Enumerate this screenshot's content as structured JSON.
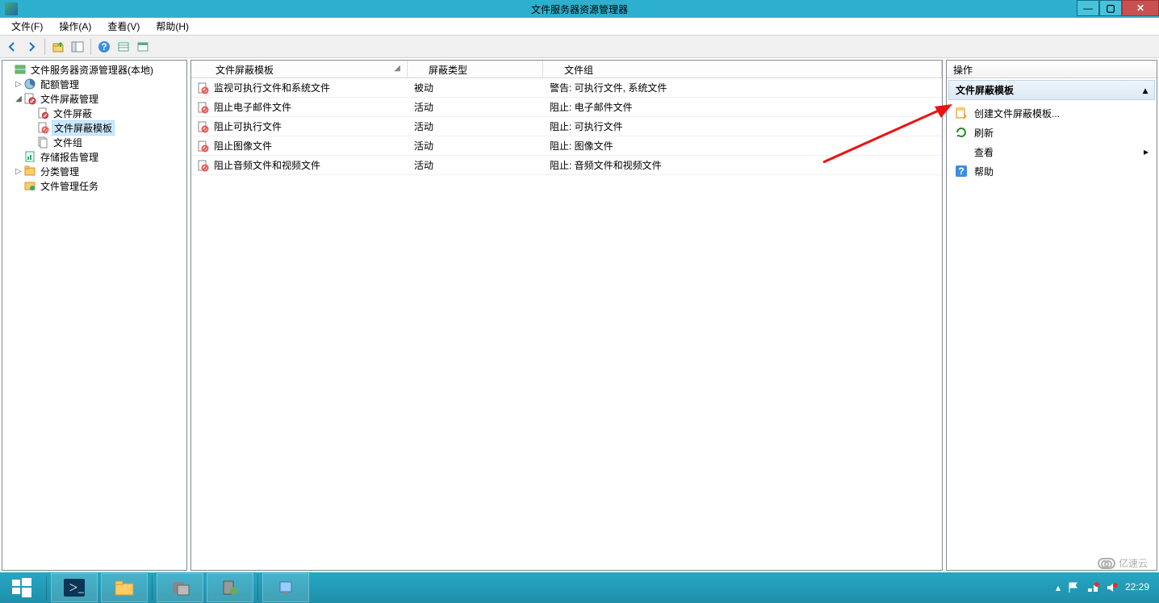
{
  "window": {
    "title": "文件服务器资源管理器"
  },
  "menu": {
    "file": "文件(F)",
    "action": "操作(A)",
    "view": "查看(V)",
    "help": "帮助(H)"
  },
  "tree": {
    "root": "文件服务器资源管理器(本地)",
    "quota": "配额管理",
    "screen_mgmt": "文件屏蔽管理",
    "screen": "文件屏蔽",
    "screen_template": "文件屏蔽模板",
    "file_group": "文件组",
    "storage_report": "存储报告管理",
    "classification": "分类管理",
    "file_task": "文件管理任务"
  },
  "columns": {
    "template": "文件屏蔽模板",
    "type": "屏蔽类型",
    "group": "文件组",
    "col1_w": 268,
    "col2_w": 168,
    "col3_w": 490
  },
  "rows": [
    {
      "template": "监视可执行文件和系统文件",
      "type": "被动",
      "group": "警告: 可执行文件, 系统文件"
    },
    {
      "template": "阻止电子邮件文件",
      "type": "活动",
      "group": "阻止: 电子邮件文件"
    },
    {
      "template": "阻止可执行文件",
      "type": "活动",
      "group": "阻止: 可执行文件"
    },
    {
      "template": "阻止图像文件",
      "type": "活动",
      "group": "阻止: 图像文件"
    },
    {
      "template": "阻止音频文件和视频文件",
      "type": "活动",
      "group": "阻止: 音频文件和视频文件"
    }
  ],
  "actions": {
    "header": "操作",
    "section": "文件屏蔽模板",
    "create": "创建文件屏蔽模板...",
    "refresh": "刷新",
    "view": "查看",
    "help": "帮助"
  },
  "taskbar": {
    "clock_time": "22:29"
  },
  "watermark": {
    "text": "亿速云"
  }
}
